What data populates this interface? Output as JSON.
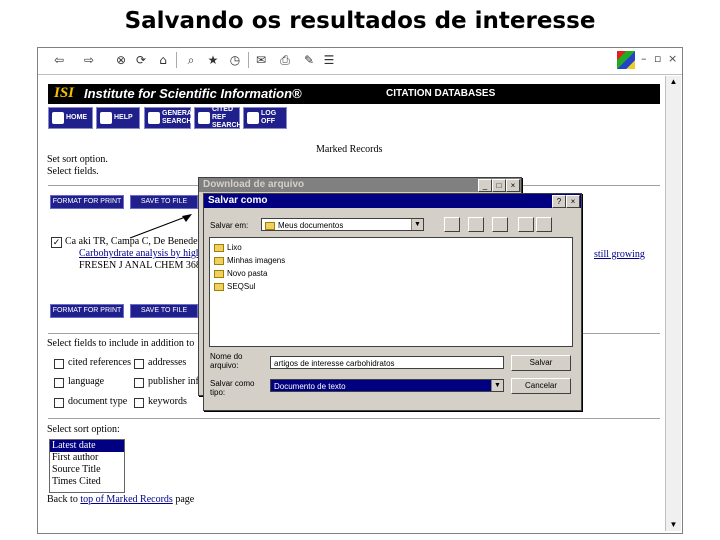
{
  "slide_title": "Salvando os resultados de interesse",
  "isi": {
    "logo": "ISI",
    "name": "Institute for Scientific Information®",
    "databases": "CITATION DATABASES"
  },
  "nav": [
    "HOME",
    "HELP",
    "GENERAL SEARCH",
    "CITED REF SEARCH",
    "LOG OFF"
  ],
  "page": {
    "heading": "Marked Records",
    "set_sort": "Set sort option.",
    "select_fields": "Select fields.",
    "format_print": "FORMAT FOR PRINT",
    "save_file": "SAVE TO FILE",
    "record": {
      "authors": "Ca aki TR, Campa C, De Benedet",
      "title": "Carbohydrate analysis by high",
      "journal": "FRESEN J ANAL CHEM 368",
      "growing": "still growing"
    },
    "select_fields_text": "Select fields to include in addition to",
    "fields": [
      "cited references",
      "addresses",
      "language",
      "publisher info",
      "document type",
      "keywords"
    ],
    "select_sort": "Select sort option:",
    "sort_options": [
      "Latest date",
      "First author",
      "Source Title",
      "Times Cited"
    ],
    "back_prefix": "Back to ",
    "back_link": "top of Marked Records",
    "back_suffix": " page"
  },
  "download_dialog": {
    "title": "Download de arquivo",
    "controls": [
      "_",
      "□",
      "×"
    ]
  },
  "save_dialog": {
    "title": "Salvar como",
    "help": "?",
    "close": "×",
    "save_in_label": "Salvar em:",
    "save_in_value": "Meus documentos",
    "folders": [
      "Lixo",
      "Minhas imagens",
      "Novo pasta",
      "SEQSul"
    ],
    "filename_label": "Nome do arquivo:",
    "filename_value": "artigos de interesse carbohidratos",
    "filetype_label": "Salvar como tipo:",
    "filetype_value": "Documento de texto",
    "save_button": "Salvar",
    "cancel_button": "Cancelar"
  },
  "colors": {
    "isi_bar": "#000000",
    "nav_button": "#20208c",
    "dialog_title_active": "#000080",
    "dialog_title_inactive": "#808080",
    "selected": "#000080"
  }
}
